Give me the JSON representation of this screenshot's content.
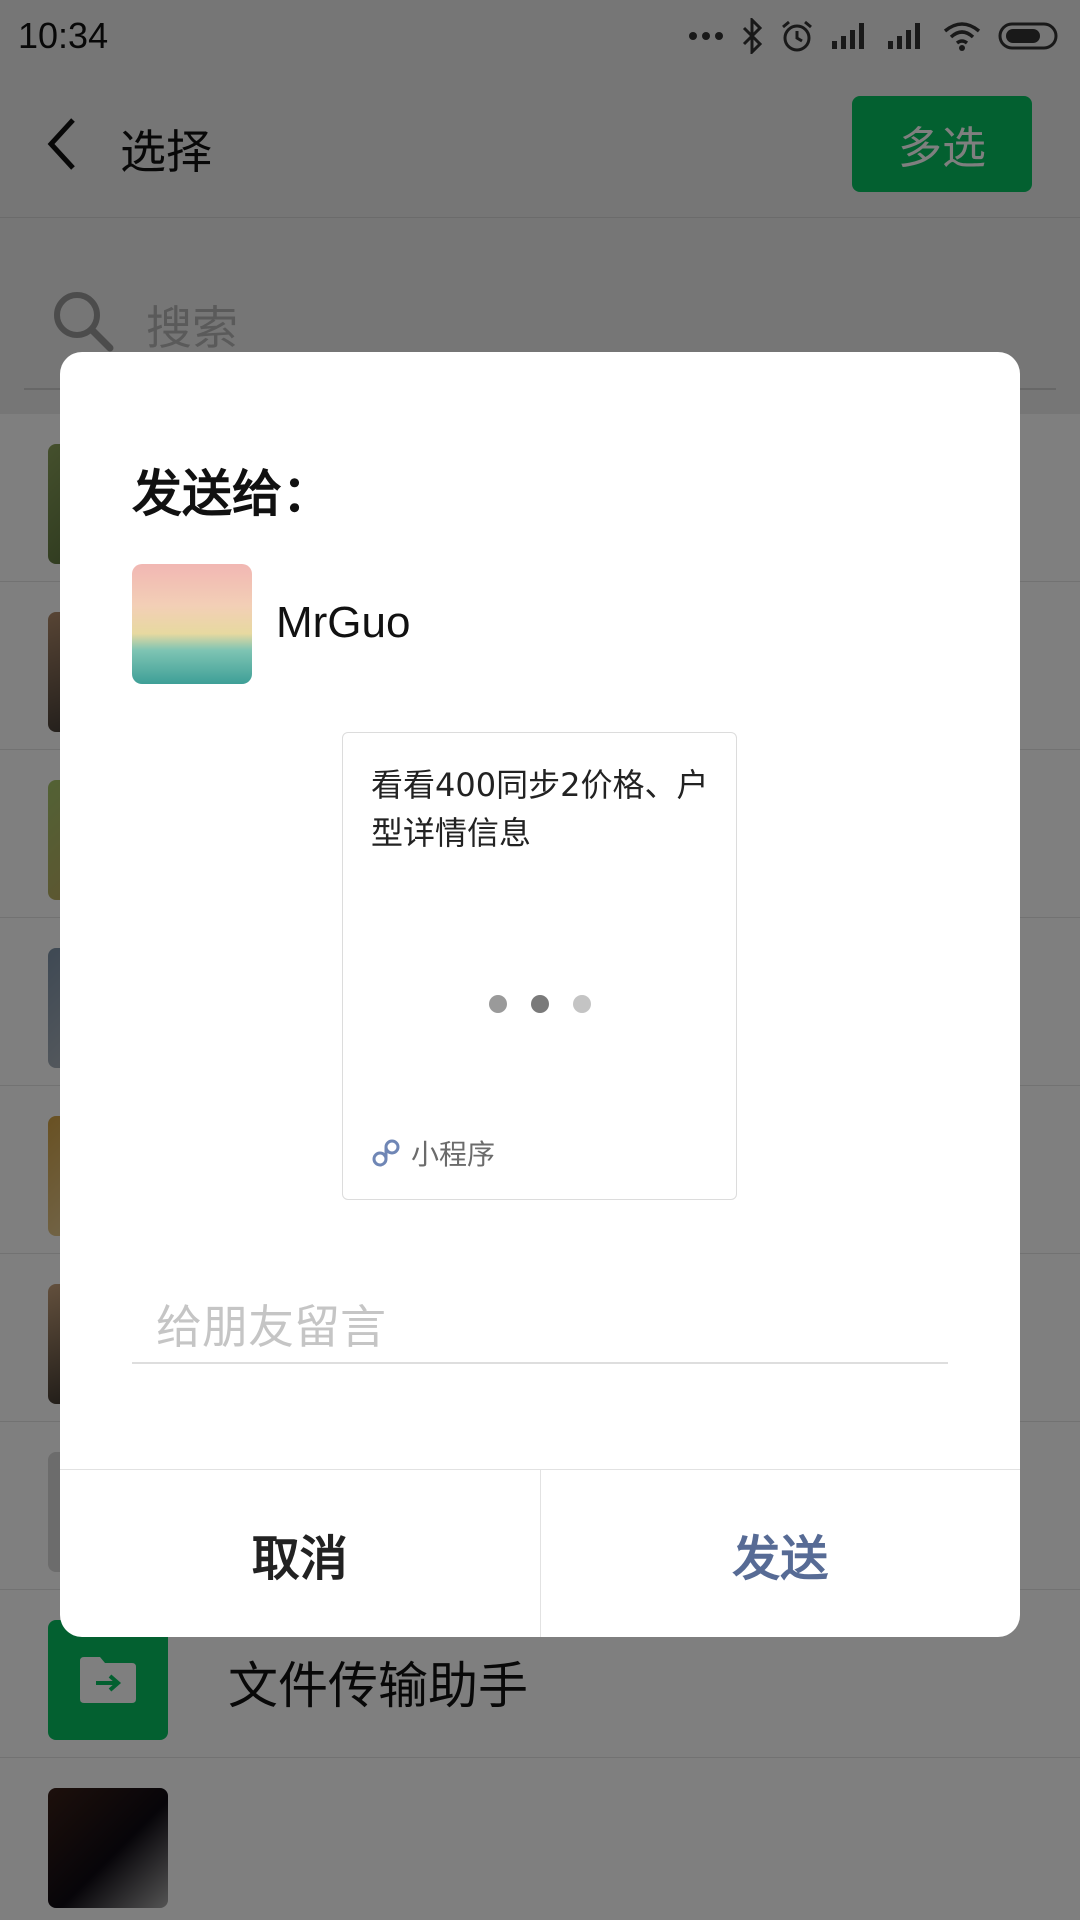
{
  "status_bar": {
    "time": "10:34"
  },
  "nav": {
    "title": "选择",
    "multi_select_label": "多选",
    "accent_color": "#07c160"
  },
  "search": {
    "placeholder": "搜索"
  },
  "list": {
    "file_transfer_label": "文件传输助手"
  },
  "dialog": {
    "title": "发送给：",
    "recipient_name": "MrGuo",
    "card": {
      "title": "看看400同步2价格、户型详情信息",
      "source_label": "小程序"
    },
    "message_placeholder": "给朋友留言",
    "cancel_label": "取消",
    "send_label": "发送",
    "send_color": "#576b95"
  }
}
